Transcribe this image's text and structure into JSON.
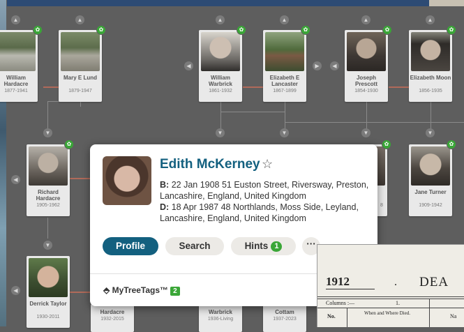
{
  "top_row": [
    {
      "name": "William Hardacre",
      "years": "1877-1941"
    },
    {
      "name": "Mary E Lund",
      "years": "1879-1947"
    },
    {
      "name": "William Warbrick",
      "years": "1861-1932"
    },
    {
      "name": "Elizabeth E Lancaster",
      "years": "1867-1899"
    },
    {
      "name": "Joseph Prescott",
      "years": "1854-1930"
    },
    {
      "name": "Elizabeth Moon",
      "years": "1856-1935"
    }
  ],
  "middle_row": [
    {
      "name": "Richard Hardacre",
      "years": "1905-1962"
    },
    {
      "name": "Jane Turner",
      "years": "1909-1942"
    },
    {
      "name": "",
      "years": "8"
    }
  ],
  "bottom_row": [
    {
      "name": "Derrick Taylor",
      "years": "1930-2011"
    },
    {
      "name": "Hardacre",
      "years": "1932-2015"
    },
    {
      "name": "Warbrick",
      "years": "1936-Living"
    },
    {
      "name": "Cottam",
      "years": "1937-2023"
    }
  ],
  "popup": {
    "name": "Edith McKerney",
    "birth_label": "B:",
    "birth": "22 Jan 1908 51 Euston Street, Riversway, Preston, Lancashire, England, United Kingdom",
    "death_label": "D:",
    "death": "18 Apr 1987 48 Northlands, Moss Side, Leyland, Lancashire, England, United Kingdom",
    "profile_label": "Profile",
    "search_label": "Search",
    "hints_label": "Hints",
    "hints_count": "1",
    "more_label": "···",
    "tags_label": "MyTreeTags™",
    "tags_count": "2"
  },
  "document": {
    "year": "1912",
    "title": "DEA",
    "columns_label": "Columns :—",
    "col_one": "1.",
    "no_label": "No.",
    "when_label": "When and Where Died.",
    "na_label": "Na"
  },
  "colors": {
    "accent": "#13607f",
    "hint_green": "#3aa637",
    "background": "#5e5e5e"
  },
  "icons": [
    "chevron-up-icon",
    "chevron-down-icon",
    "chevron-left-icon",
    "chevron-right-icon",
    "leaf-hint-icon",
    "star-icon",
    "tag-icon"
  ]
}
